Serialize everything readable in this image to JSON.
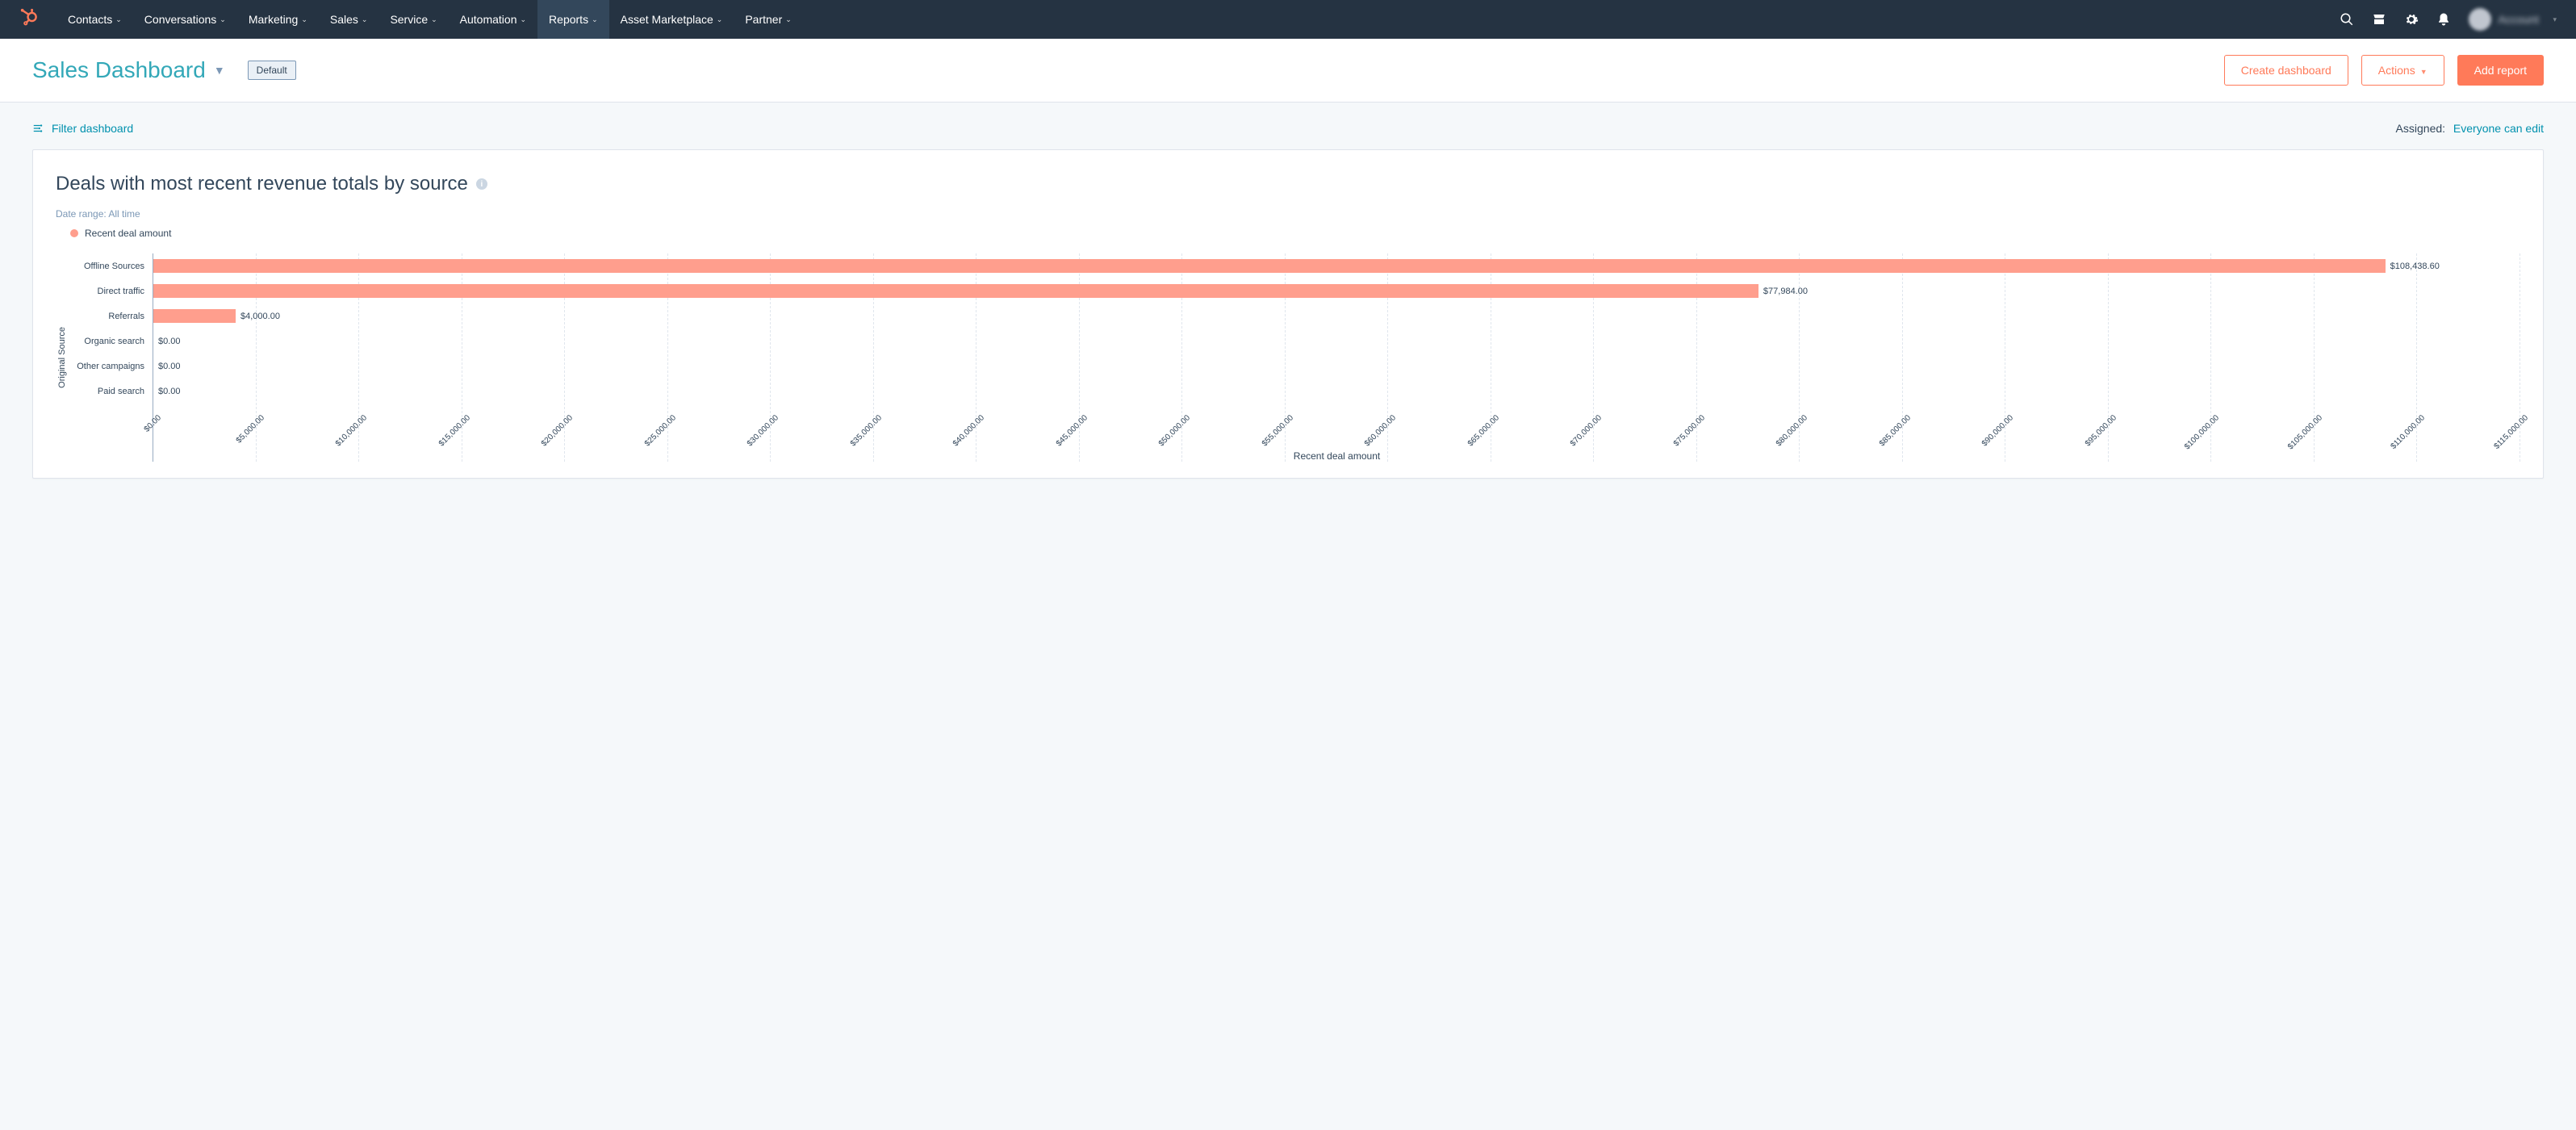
{
  "nav": {
    "items": [
      {
        "label": "Contacts"
      },
      {
        "label": "Conversations"
      },
      {
        "label": "Marketing"
      },
      {
        "label": "Sales"
      },
      {
        "label": "Service"
      },
      {
        "label": "Automation"
      },
      {
        "label": "Reports",
        "active": true
      },
      {
        "label": "Asset Marketplace"
      },
      {
        "label": "Partner"
      }
    ]
  },
  "header": {
    "title": "Sales Dashboard",
    "badge": "Default",
    "create": "Create dashboard",
    "actions": "Actions",
    "add": "Add report"
  },
  "filters": {
    "label": "Filter dashboard",
    "assigned_label": "Assigned:",
    "assigned_value": "Everyone can edit"
  },
  "card": {
    "title": "Deals with most recent revenue totals by source",
    "daterange_label": "Date range:",
    "daterange_value": "All time",
    "legend": "Recent deal amount",
    "yaxis": "Original Source",
    "xaxis": "Recent deal amount"
  },
  "chart_data": {
    "type": "bar",
    "orientation": "horizontal",
    "title": "Deals with most recent revenue totals by source",
    "ylabel": "Original Source",
    "xlabel": "Recent deal amount",
    "xlim": [
      0,
      115000
    ],
    "x_tick_step": 5000,
    "categories": [
      "Offline Sources",
      "Direct traffic",
      "Referrals",
      "Organic search",
      "Other campaigns",
      "Paid search"
    ],
    "values": [
      108438.6,
      77984.0,
      4000.0,
      0.0,
      0.0,
      0.0
    ],
    "value_labels": [
      "$108,438.60",
      "$77,984.00",
      "$4,000.00",
      "$0.00",
      "$0.00",
      "$0.00"
    ],
    "series_name": "Recent deal amount",
    "bar_color": "#ff9e8d",
    "x_ticks": [
      "$0.00",
      "$5,000.00",
      "$10,000.00",
      "$15,000.00",
      "$20,000.00",
      "$25,000.00",
      "$30,000.00",
      "$35,000.00",
      "$40,000.00",
      "$45,000.00",
      "$50,000.00",
      "$55,000.00",
      "$60,000.00",
      "$65,000.00",
      "$70,000.00",
      "$75,000.00",
      "$80,000.00",
      "$85,000.00",
      "$90,000.00",
      "$95,000.00",
      "$100,000.00",
      "$105,000.00",
      "$110,000.00",
      "$115,000.00"
    ]
  }
}
